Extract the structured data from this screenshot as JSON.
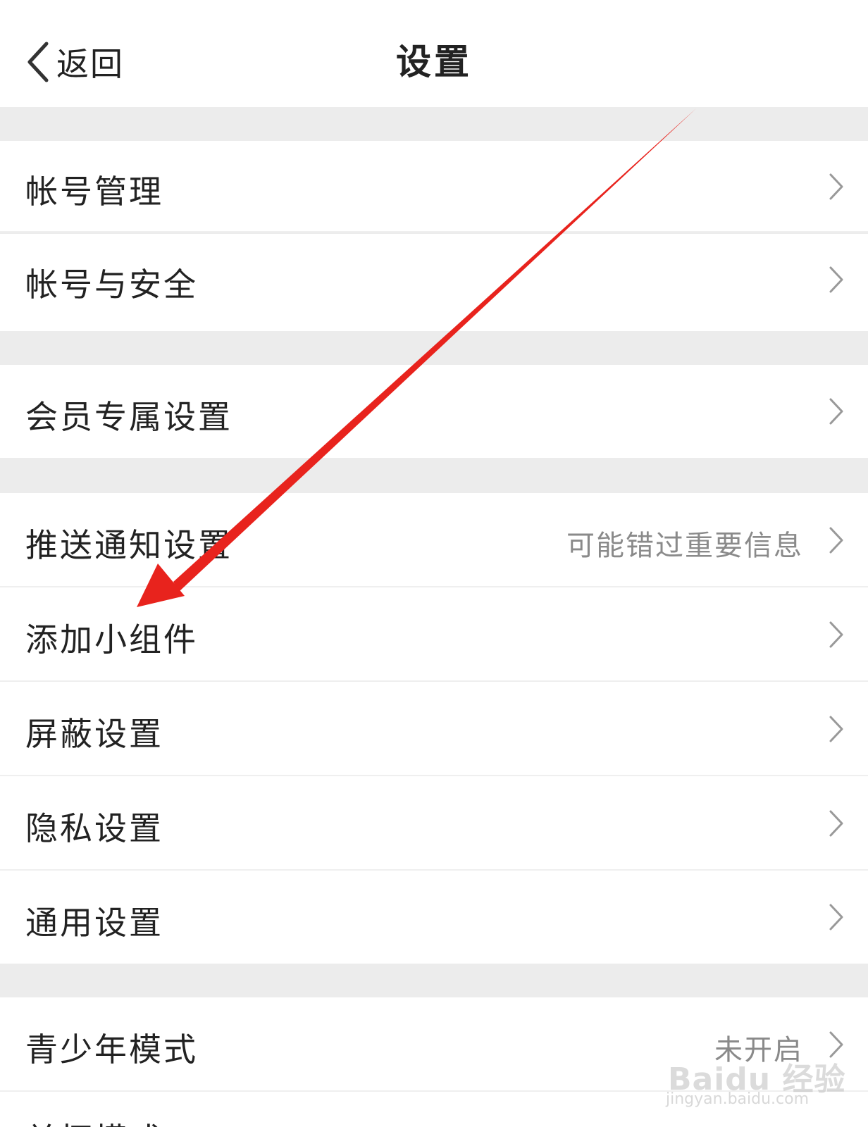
{
  "header": {
    "back_label": "返回",
    "title": "设置"
  },
  "settings": {
    "account_manage": "帐号管理",
    "account_security": "帐号与安全",
    "vip_settings": "会员专属设置",
    "push_settings": "推送通知设置",
    "push_settings_value": "可能错过重要信息",
    "add_widget": "添加小组件",
    "block_settings": "屏蔽设置",
    "privacy_settings": "隐私设置",
    "general_settings": "通用设置",
    "youth_mode": "青少年模式",
    "youth_mode_value": "未开启",
    "care_mode": "关怀模式"
  },
  "annotation": {
    "arrow_color": "#e8231d",
    "points_to": "add_widget"
  },
  "watermark": {
    "logo_text": "Baidu 经验",
    "url": "jingyan.baidu.com"
  }
}
